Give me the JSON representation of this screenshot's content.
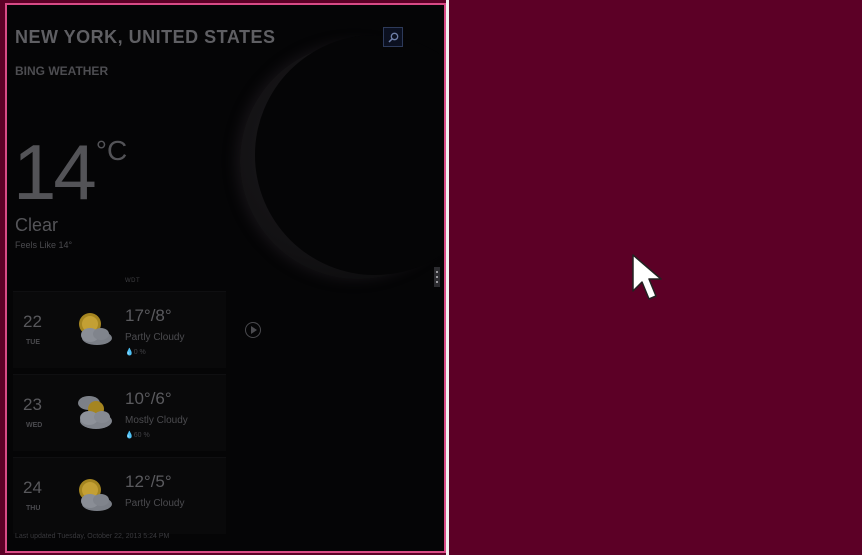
{
  "weather_app": {
    "location": "NEW YORK, UNITED STATES",
    "provider": "BING WEATHER",
    "current": {
      "temperature": "14",
      "unit": "°C",
      "condition": "Clear",
      "feels_like": "Feels Like 14°"
    },
    "source_label": "WDT",
    "forecast": [
      {
        "day_num": "22",
        "day_name": "TUE",
        "hi_lo": "17°/8°",
        "desc": "Partly Cloudy",
        "precip": "💧0 %",
        "icon": "partly-cloudy-icon"
      },
      {
        "day_num": "23",
        "day_name": "WED",
        "hi_lo": "10°/6°",
        "desc": "Mostly Cloudy",
        "precip": "💧60 %",
        "icon": "mostly-cloudy-icon"
      },
      {
        "day_num": "24",
        "day_name": "THU",
        "hi_lo": "12°/5°",
        "desc": "Partly Cloudy",
        "precip": "",
        "icon": "partly-cloudy-icon"
      }
    ],
    "last_updated": "Last updated Tuesday, October 22, 2013 5:24 PM"
  },
  "colors": {
    "desktop_background": "#5c0026",
    "pane_border": "#d84b86",
    "splitter": "#f0f0f0"
  }
}
